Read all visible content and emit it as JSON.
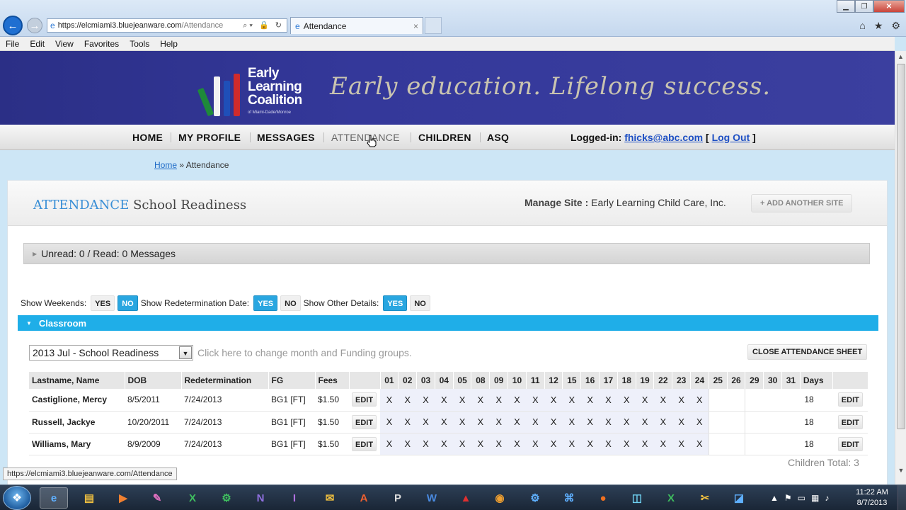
{
  "browser": {
    "address_host": "https://elcmiami3.bluejeanware.com",
    "address_path": "/Attendance",
    "tab_title": "Attendance",
    "tab_close": "×",
    "back_glyph": "←",
    "forward_glyph": "→",
    "addr_icons": "⌕▾ 🔒 ↻",
    "menu": [
      "File",
      "Edit",
      "View",
      "Favorites",
      "Tools",
      "Help"
    ],
    "status_url": "https://elcmiami3.bluejeanware.com/Attendance"
  },
  "banner": {
    "logo_lines": [
      "Early",
      "Learning",
      "Coalition"
    ],
    "logo_sub": "of Miami-Dade/Monroe",
    "tagline": "Early education.  Lifelong success."
  },
  "nav": {
    "items": [
      "HOME",
      "MY PROFILE",
      "MESSAGES",
      "ATTENDANCE",
      "CHILDREN",
      "ASQ"
    ],
    "logged_in_label": "Logged-in:",
    "user_email": "fhicks@abc.com",
    "bracket_open": "[",
    "logout": "Log Out",
    "bracket_close": "]"
  },
  "breadcrumb": {
    "home": "Home",
    "sep": "»",
    "current": "Attendance"
  },
  "header": {
    "title_accent": "ATTENDANCE",
    "title_rest": "School Readiness",
    "manage_site_label": "Manage Site :",
    "manage_site_value": "Early Learning Child Care, Inc.",
    "add_site": "+ ADD ANOTHER SITE"
  },
  "messages": {
    "text": "Unread: 0 / Read: 0 Messages"
  },
  "options": {
    "weekends_label": "Show Weekends:",
    "redetermination_label": "Show Redetermination Date:",
    "other_label": "Show Other Details:",
    "yes": "YES",
    "no": "NO",
    "weekends_selected": "NO",
    "redetermination_selected": "YES",
    "other_selected": "YES"
  },
  "classroom": {
    "label": "Classroom"
  },
  "sheet": {
    "period": "2013 Jul - School Readiness",
    "change_hint": "Click here to change month and Funding groups.",
    "close_sheet": "CLOSE ATTENDANCE SHEET",
    "children_total": "Children Total: 3"
  },
  "table": {
    "columns": [
      "Lastname, Name",
      "DOB",
      "Redetermination",
      "FG",
      "Fees",
      ""
    ],
    "days": [
      "01",
      "02",
      "03",
      "04",
      "05",
      "08",
      "09",
      "10",
      "11",
      "12",
      "15",
      "16",
      "17",
      "18",
      "19",
      "22",
      "23",
      "24",
      "25",
      "26",
      "29",
      "30",
      "31"
    ],
    "days_col": "Days",
    "edit_label": "EDIT",
    "rows": [
      {
        "name": "Castiglione, Mercy",
        "dob": "8/5/2011",
        "redetermination": "7/24/2013",
        "fg": "BG1 [FT]",
        "fees": "$1.50",
        "marks": [
          "X",
          "X",
          "X",
          "X",
          "X",
          "X",
          "X",
          "X",
          "X",
          "X",
          "X",
          "X",
          "X",
          "X",
          "X",
          "X",
          "X",
          "X",
          "",
          "",
          "",
          "",
          ""
        ],
        "days": "18"
      },
      {
        "name": "Russell, Jackye",
        "dob": "10/20/2011",
        "redetermination": "7/24/2013",
        "fg": "BG1 [FT]",
        "fees": "$1.50",
        "marks": [
          "X",
          "X",
          "X",
          "X",
          "X",
          "X",
          "X",
          "X",
          "X",
          "X",
          "X",
          "X",
          "X",
          "X",
          "X",
          "X",
          "X",
          "X",
          "",
          "",
          "",
          "",
          ""
        ],
        "days": "18"
      },
      {
        "name": "Williams, Mary",
        "dob": "8/9/2009",
        "redetermination": "7/24/2013",
        "fg": "BG1 [FT]",
        "fees": "$1.50",
        "marks": [
          "X",
          "X",
          "X",
          "X",
          "X",
          "X",
          "X",
          "X",
          "X",
          "X",
          "X",
          "X",
          "X",
          "X",
          "X",
          "X",
          "X",
          "X",
          "",
          "",
          "",
          "",
          ""
        ],
        "days": "18"
      }
    ]
  },
  "taskbar": {
    "clock_time": "11:22 AM",
    "clock_date": "8/7/2013"
  },
  "colors": {
    "banner": "#2b2f86",
    "accent_blue": "#29a6e0",
    "title_blue": "#3a8fd6",
    "link_blue": "#1d4fc4"
  },
  "icons": {
    "back": "back-arrow-icon",
    "forward": "forward-arrow-icon",
    "home": "home-icon",
    "favorites": "star-icon",
    "tools": "gear-icon",
    "ie": "internet-explorer-icon"
  }
}
